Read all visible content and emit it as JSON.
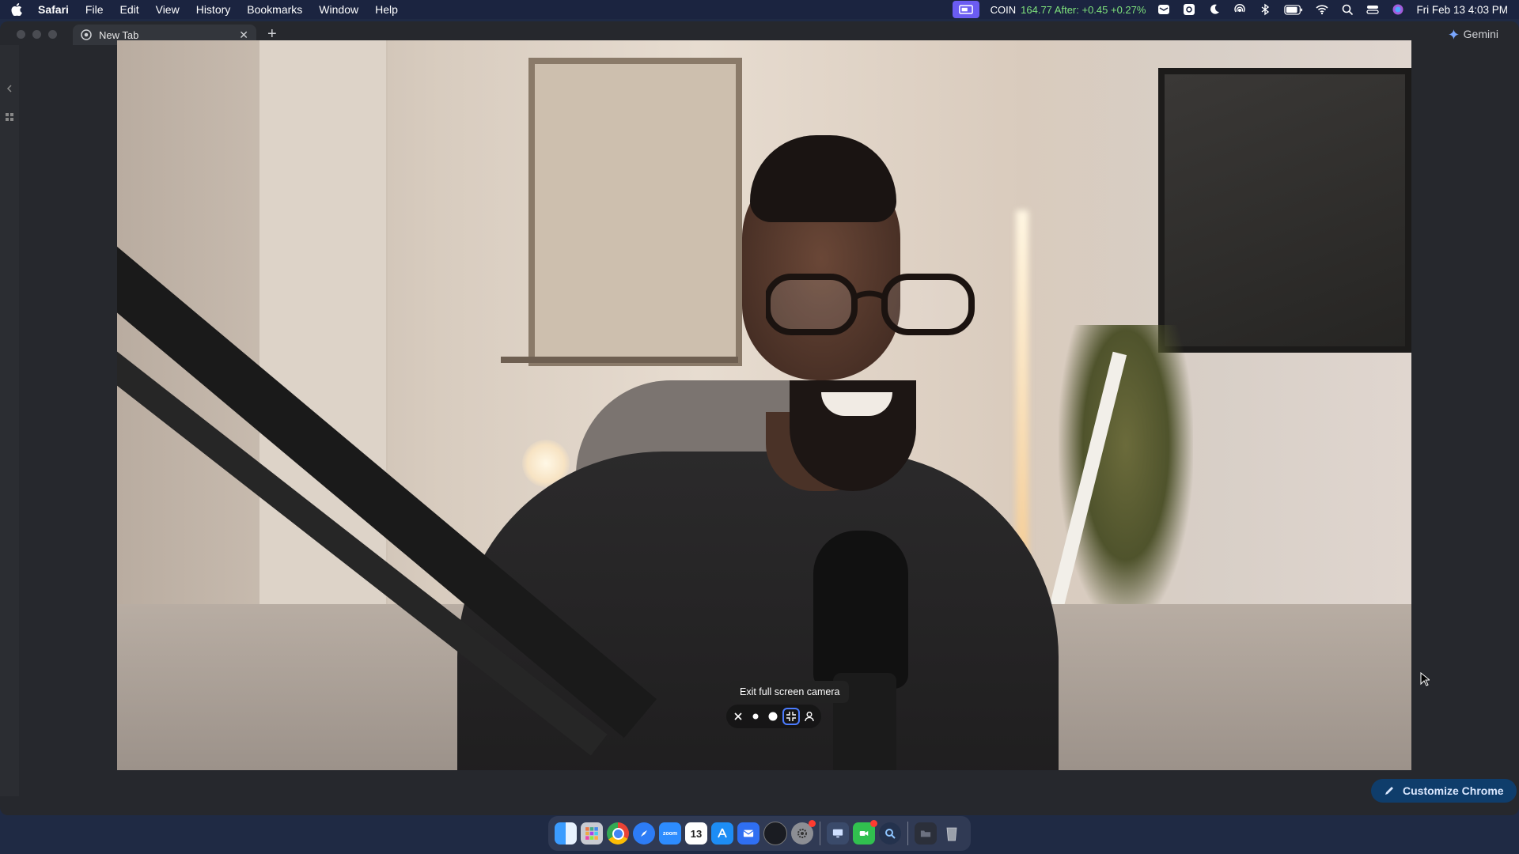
{
  "menubar": {
    "app_name": "Safari",
    "menus": [
      "File",
      "Edit",
      "View",
      "History",
      "Bookmarks",
      "Window",
      "Help"
    ],
    "ticker_symbol": "COIN",
    "ticker_value": "164.77 After: +0.45 +0.27%",
    "clock": "Fri Feb 13  4:03 PM",
    "icons": [
      "screen-share",
      "mail",
      "gear",
      "moon",
      "airdrop",
      "bluetooth",
      "battery",
      "wifi",
      "search",
      "control-center",
      "siri"
    ]
  },
  "browser": {
    "tab_title": "New Tab",
    "gemini_label": "Gemini",
    "customize_label": "Customize Chrome"
  },
  "camera": {
    "tooltip": "Exit full screen camera"
  },
  "dock": {
    "apps": [
      "Finder",
      "Launchpad",
      "Chrome",
      "Safari",
      "Zoom",
      "Calendar",
      "App Store",
      "Mail",
      "Screen Studio",
      "Settings",
      "Display",
      "FaceTime",
      "Proxyman",
      "Other",
      "Trash"
    ],
    "calendar_day": "13",
    "zoom_label": "zoom"
  },
  "colors": {
    "menubar_bg": "#1b2440",
    "ticker_positive": "#7fe27c",
    "accent_blue": "#4c7cff",
    "customize_bg": "#0f3d6b"
  }
}
